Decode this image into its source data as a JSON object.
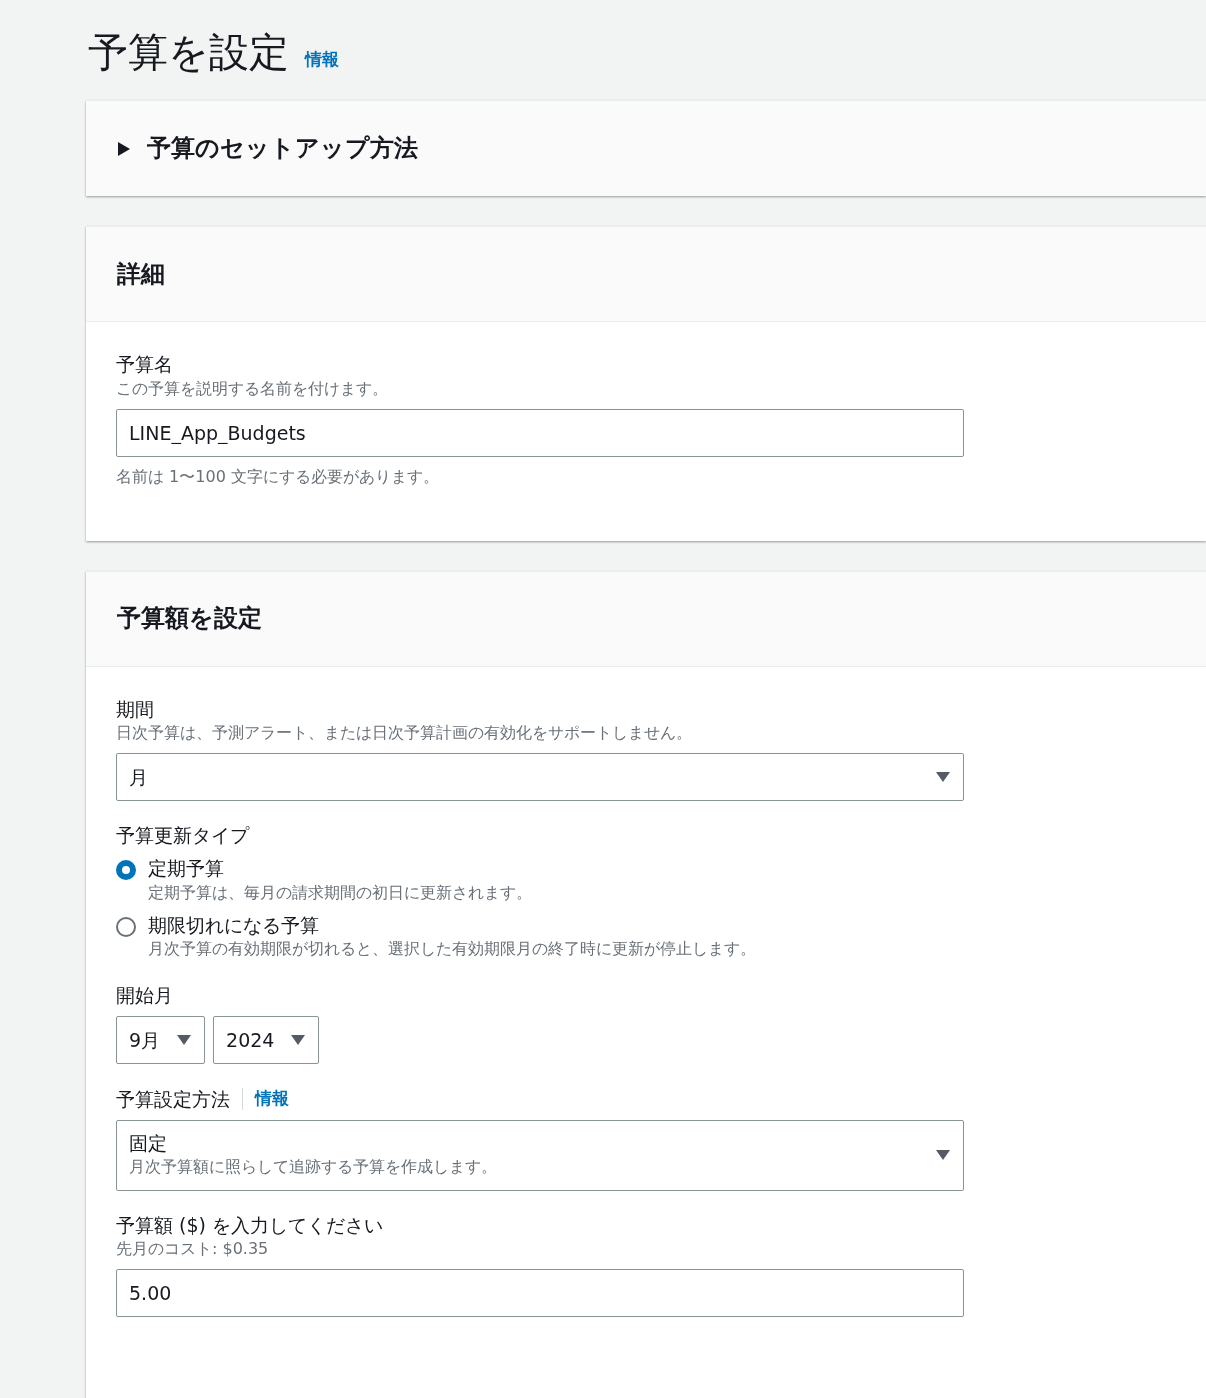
{
  "page": {
    "title": "予算を設定",
    "info_link": "情報"
  },
  "sections": [
    {
      "kind": "expander",
      "title": "予算のセットアップ方法",
      "expanded": false
    },
    {
      "kind": "form",
      "title": "詳細",
      "fields": [
        {
          "kind": "text",
          "label": "予算名",
          "description": "この予算を説明する名前を付けます。",
          "value": "LINE_App_Budgets",
          "constraint": "名前は 1〜100 文字にする必要があります。"
        }
      ]
    },
    {
      "kind": "form",
      "title": "予算額を設定",
      "fields": [
        {
          "kind": "select",
          "label": "期間",
          "description": "日次予算は、予測アラート、または日次予算計画の有効化をサポートしません。",
          "value": "月"
        },
        {
          "kind": "radio",
          "label": "予算更新タイプ",
          "options": [
            {
              "label": "定期予算",
              "description": "定期予算は、毎月の請求期間の初日に更新されます。",
              "selected": true
            },
            {
              "label": "期限切れになる予算",
              "description": "月次予算の有効期限が切れると、選択した有効期限月の終了時に更新が停止します。",
              "selected": false
            }
          ]
        },
        {
          "kind": "select_group",
          "label": "開始月",
          "selects": [
            {
              "value": "9月"
            },
            {
              "value": "2024"
            }
          ]
        },
        {
          "kind": "select_detail",
          "label": "予算設定方法",
          "info_link": "情報",
          "value": "固定",
          "value_description": "月次予算額に照らして追跡する予算を作成します。"
        },
        {
          "kind": "text",
          "label": "予算額 ($) を入力してください",
          "description": "先月のコスト: $0.35",
          "value": "5.00"
        }
      ]
    }
  ]
}
